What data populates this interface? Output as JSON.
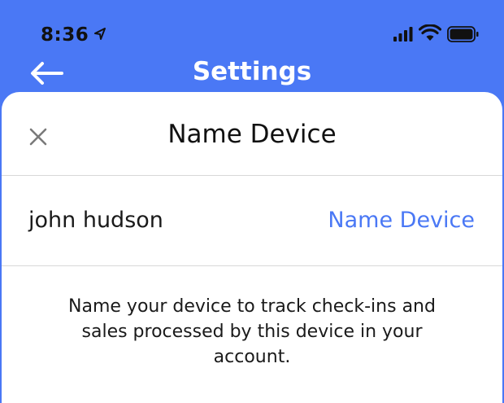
{
  "status_bar": {
    "time": "8:36"
  },
  "nav": {
    "title": "Settings"
  },
  "sheet": {
    "title": "Name Device",
    "device_name": "john hudson",
    "action_label": "Name Device",
    "description": "Name your device to track check-ins and sales processed by this device in your account."
  },
  "colors": {
    "accent": "#4a78f5",
    "text": "#1a1a1a",
    "divider": "#d8d8d8"
  },
  "icons": {
    "status": [
      "location-arrow-icon",
      "cellular-signal-icon",
      "wifi-icon",
      "battery-icon"
    ],
    "nav": "back-arrow-icon",
    "sheet": "close-icon"
  }
}
